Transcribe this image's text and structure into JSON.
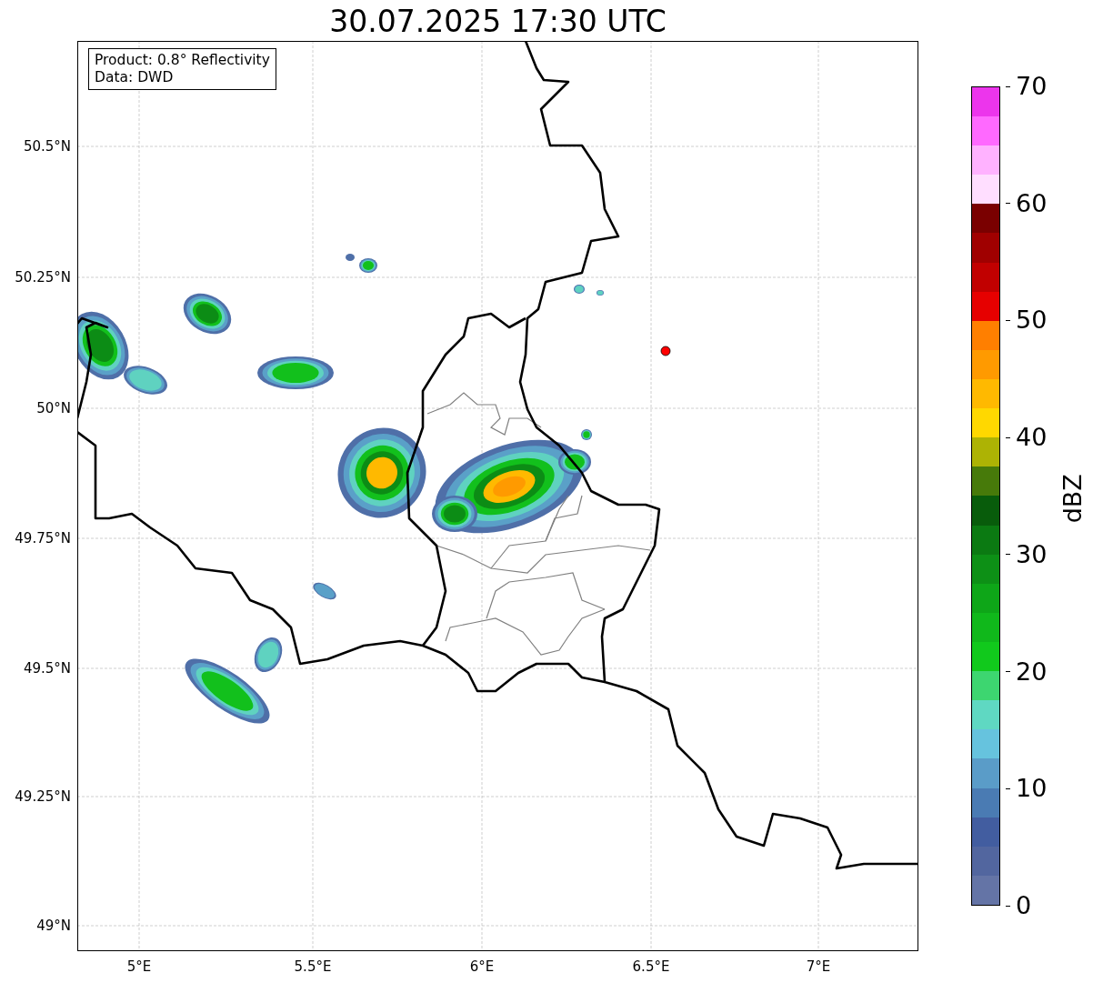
{
  "title": "30.07.2025 17:30 UTC",
  "info_box": [
    "Product: 0.8° Reflectivity",
    "Data: DWD"
  ],
  "map": {
    "yticks": [
      "50.5°N",
      "50.25°N",
      "50°N",
      "49.75°N",
      "49.5°N",
      "49.25°N",
      "49°N"
    ],
    "xticks": [
      "5°E",
      "5.5°E",
      "6°E",
      "6.5°E",
      "7°E"
    ]
  },
  "colorbar": {
    "label": "dBZ",
    "ticks": [
      "70",
      "60",
      "50",
      "40",
      "30",
      "20",
      "10",
      "0"
    ],
    "segments": [
      {
        "color": "#6474a6"
      },
      {
        "color": "#52669f"
      },
      {
        "color": "#425da0"
      },
      {
        "color": "#4a7bb3"
      },
      {
        "color": "#5a9cc8"
      },
      {
        "color": "#66c3de"
      },
      {
        "color": "#5fd8c2"
      },
      {
        "color": "#3dd670"
      },
      {
        "color": "#11c91c"
      },
      {
        "color": "#10b81b"
      },
      {
        "color": "#0ea618"
      },
      {
        "color": "#0d9016"
      },
      {
        "color": "#0b7a12"
      },
      {
        "color": "#085c0b"
      },
      {
        "color": "#477a0a"
      },
      {
        "color": "#adb304"
      },
      {
        "color": "#ffd800"
      },
      {
        "color": "#ffb900"
      },
      {
        "color": "#ff9a00"
      },
      {
        "color": "#ff7f00"
      },
      {
        "color": "#e60000"
      },
      {
        "color": "#c10000"
      },
      {
        "color": "#a00000"
      },
      {
        "color": "#7a0000"
      },
      {
        "color": "#ffdeff"
      },
      {
        "color": "#ffb2ff"
      },
      {
        "color": "#ff69ff"
      },
      {
        "color": "#ec35ec"
      }
    ]
  }
}
